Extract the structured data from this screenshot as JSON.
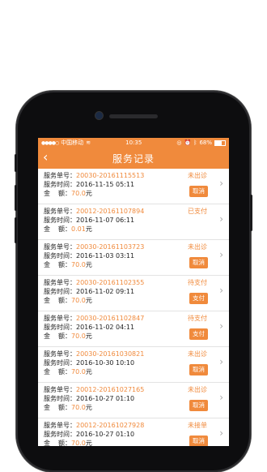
{
  "status_bar": {
    "carrier": "中国移动",
    "time": "10:35",
    "battery": "68%"
  },
  "header": {
    "back_icon": "‹",
    "title": "服务记录"
  },
  "labels": {
    "order_no": "服务单号：",
    "service_time": "服务时间：",
    "amount_1": "金",
    "amount_2": "额：",
    "yuan": "元"
  },
  "records": [
    {
      "order_no": "20030-20161115513",
      "time": "2016-11-15 05:11",
      "amount": "70.0",
      "status": "未出诊",
      "action": "取消"
    },
    {
      "order_no": "20012-20161107894",
      "time": "2016-11-07 06:11",
      "amount": "0.01",
      "status": "已支付",
      "action": ""
    },
    {
      "order_no": "20030-20161103723",
      "time": "2016-11-03 03:11",
      "amount": "70.0",
      "status": "未出诊",
      "action": "取消"
    },
    {
      "order_no": "20030-20161102355",
      "time": "2016-11-02 09:11",
      "amount": "70.0",
      "status": "待支付",
      "action": "支付"
    },
    {
      "order_no": "20030-20161102847",
      "time": "2016-11-02 04:11",
      "amount": "70.0",
      "status": "待支付",
      "action": "支付"
    },
    {
      "order_no": "20030-20161030821",
      "time": "2016-10-30 10:10",
      "amount": "70.0",
      "status": "未出诊",
      "action": "取消"
    },
    {
      "order_no": "20012-20161027165",
      "time": "2016-10-27 01:10",
      "amount": "70.0",
      "status": "未出诊",
      "action": "取消"
    },
    {
      "order_no": "20012-20161027928",
      "time": "2016-10-27 01:10",
      "amount": "70.0",
      "status": "未接单",
      "action": "取消"
    }
  ],
  "colors": {
    "accent": "#f08a3c"
  }
}
